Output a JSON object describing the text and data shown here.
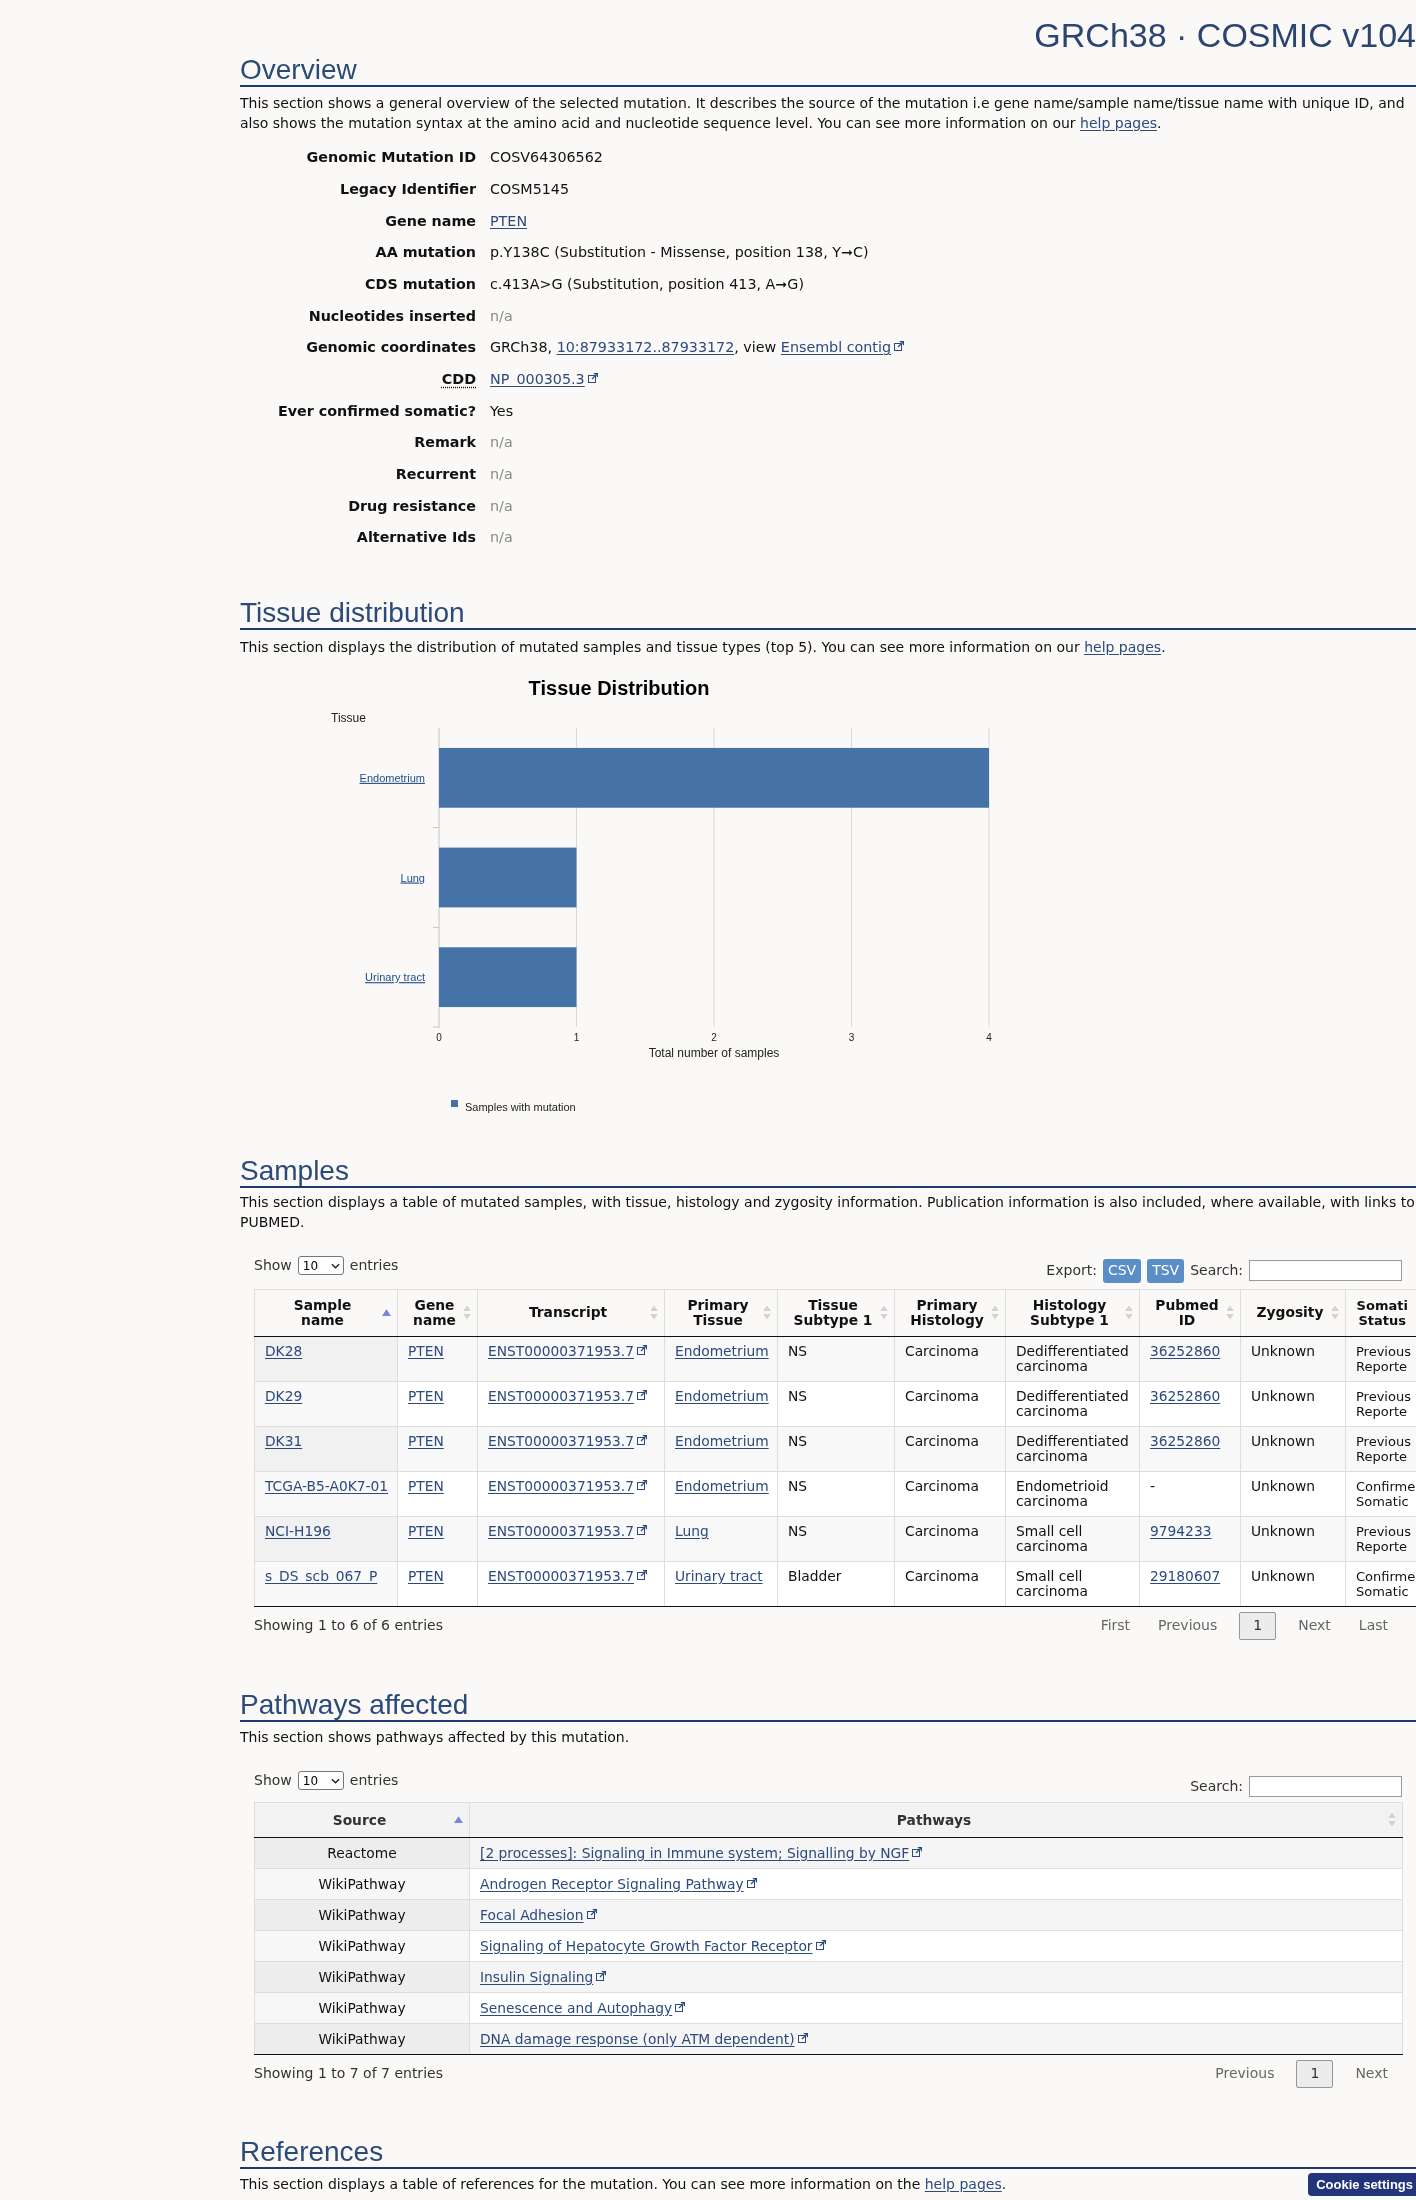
{
  "header": {
    "title": "GRCh38 · COSMIC v104"
  },
  "overview": {
    "heading": "Overview",
    "description": {
      "text": "This section shows a general overview of the selected mutation. It describes the source of the mutation i.e gene name/sample name/tissue name with unique ID, and also shows the mutation syntax at the amino acid and nucleotide sequence level. You can see more information on our ",
      "link": "help pages",
      "end": "."
    },
    "fields": [
      {
        "label": "Genomic Mutation ID",
        "abbreviation": false,
        "value": [
          {
            "kind": "text",
            "text": "COSV64306562"
          }
        ]
      },
      {
        "label": "Legacy Identifier",
        "abbreviation": false,
        "value": [
          {
            "kind": "text",
            "text": "COSM5145"
          }
        ]
      },
      {
        "label": "Gene name",
        "abbreviation": false,
        "value": [
          {
            "kind": "link",
            "text": "PTEN"
          }
        ]
      },
      {
        "label": "AA mutation",
        "abbreviation": false,
        "value": [
          {
            "kind": "text",
            "text": "p.Y138C (Substitution - Missense, position 138, Y➞C)"
          }
        ]
      },
      {
        "label": "CDS mutation",
        "abbreviation": false,
        "value": [
          {
            "kind": "text",
            "text": "c.413A>G (Substitution, position 413, A➞G)"
          }
        ]
      },
      {
        "label": "Nucleotides inserted",
        "abbreviation": false,
        "value": [
          {
            "kind": "na",
            "text": "n/a"
          }
        ]
      },
      {
        "label": "Genomic coordinates",
        "abbreviation": false,
        "value": [
          {
            "kind": "text",
            "text": "GRCh38, "
          },
          {
            "kind": "link",
            "text": "10:87933172..87933172"
          },
          {
            "kind": "text",
            "text": ", view "
          },
          {
            "kind": "external_link",
            "text": "Ensembl contig"
          }
        ]
      },
      {
        "label": "CDD",
        "abbreviation": true,
        "value": [
          {
            "kind": "external_link",
            "text": "NP_000305.3"
          }
        ]
      },
      {
        "label": "Ever confirmed somatic?",
        "abbreviation": false,
        "value": [
          {
            "kind": "text",
            "text": "Yes"
          }
        ]
      },
      {
        "label": "Remark",
        "abbreviation": false,
        "value": [
          {
            "kind": "na",
            "text": "n/a"
          }
        ]
      },
      {
        "label": "Recurrent",
        "abbreviation": false,
        "value": [
          {
            "kind": "na",
            "text": "n/a"
          }
        ]
      },
      {
        "label": "Drug resistance",
        "abbreviation": false,
        "value": [
          {
            "kind": "na",
            "text": "n/a"
          }
        ]
      },
      {
        "label": "Alternative Ids",
        "abbreviation": false,
        "value": [
          {
            "kind": "na",
            "text": "n/a"
          }
        ]
      }
    ]
  },
  "tissue_distribution": {
    "heading": "Tissue distribution",
    "description": {
      "text": "This section displays the distribution of mutated samples and tissue types (top 5). You can see more information on our ",
      "link": "help pages",
      "end": "."
    },
    "chart_data": {
      "type": "bar",
      "orientation": "horizontal",
      "title": "Tissue Distribution",
      "ylabel": "Tissue",
      "xlabel": "Total number of samples",
      "categories": [
        "Endometrium",
        "Lung",
        "Urinary tract"
      ],
      "series": [
        {
          "name": "Samples with mutation",
          "color": "#4673a7",
          "values": [
            4,
            1,
            1
          ]
        }
      ],
      "xlim": [
        0,
        4
      ],
      "xticks": [
        0,
        1,
        2,
        3,
        4
      ],
      "grid": true
    }
  },
  "samples": {
    "heading": "Samples",
    "description": {
      "text": "This section displays a table of mutated samples, with tissue, histology and zygosity information. Publication information is also included, where available, with links to PUBMED."
    },
    "length_menu": {
      "label_before": "Show",
      "value": "10",
      "label_after": "entries"
    },
    "export": {
      "label": "Export:",
      "buttons": [
        "CSV",
        "TSV"
      ]
    },
    "search": {
      "label": "Search:"
    },
    "table": {
      "columns": [
        {
          "label": "Sample name",
          "sorted": true
        },
        {
          "label": "Gene name",
          "sorted": false
        },
        {
          "label": "Transcript",
          "sorted": false
        },
        {
          "label": "Primary Tissue",
          "sorted": false
        },
        {
          "label": "Tissue Subtype 1",
          "sorted": false
        },
        {
          "label": "Primary Histology",
          "sorted": false
        },
        {
          "label": "Histology Subtype 1",
          "sorted": false
        },
        {
          "label": "Pubmed ID",
          "sorted": false
        },
        {
          "label": "Zygosity",
          "sorted": false
        },
        {
          "label": "Somati Status"
        }
      ],
      "rows": [
        [
          {
            "kind": "link",
            "text": "DK28"
          },
          {
            "kind": "link",
            "text": "PTEN"
          },
          {
            "kind": "external_link",
            "text": "ENST00000371953.7"
          },
          {
            "kind": "link",
            "text": "Endometrium"
          },
          {
            "kind": "text",
            "text": "NS"
          },
          {
            "kind": "text",
            "text": "Carcinoma"
          },
          {
            "kind": "text",
            "text": "Dedifferentiated carcinoma"
          },
          {
            "kind": "link",
            "text": "36252860"
          },
          {
            "kind": "text",
            "text": "Unknown"
          },
          {
            "kind": "text",
            "text": "Previous Reporte"
          }
        ],
        [
          {
            "kind": "link",
            "text": "DK29"
          },
          {
            "kind": "link",
            "text": "PTEN"
          },
          {
            "kind": "external_link",
            "text": "ENST00000371953.7"
          },
          {
            "kind": "link",
            "text": "Endometrium"
          },
          {
            "kind": "text",
            "text": "NS"
          },
          {
            "kind": "text",
            "text": "Carcinoma"
          },
          {
            "kind": "text",
            "text": "Dedifferentiated carcinoma"
          },
          {
            "kind": "link",
            "text": "36252860"
          },
          {
            "kind": "text",
            "text": "Unknown"
          },
          {
            "kind": "text",
            "text": "Previous Reporte"
          }
        ],
        [
          {
            "kind": "link",
            "text": "DK31"
          },
          {
            "kind": "link",
            "text": "PTEN"
          },
          {
            "kind": "external_link",
            "text": "ENST00000371953.7"
          },
          {
            "kind": "link",
            "text": "Endometrium"
          },
          {
            "kind": "text",
            "text": "NS"
          },
          {
            "kind": "text",
            "text": "Carcinoma"
          },
          {
            "kind": "text",
            "text": "Dedifferentiated carcinoma"
          },
          {
            "kind": "link",
            "text": "36252860"
          },
          {
            "kind": "text",
            "text": "Unknown"
          },
          {
            "kind": "text",
            "text": "Previous Reporte"
          }
        ],
        [
          {
            "kind": "link",
            "text": "TCGA-B5-A0K7-01"
          },
          {
            "kind": "link",
            "text": "PTEN"
          },
          {
            "kind": "external_link",
            "text": "ENST00000371953.7"
          },
          {
            "kind": "link",
            "text": "Endometrium"
          },
          {
            "kind": "text",
            "text": "NS"
          },
          {
            "kind": "text",
            "text": "Carcinoma"
          },
          {
            "kind": "text",
            "text": "Endometrioid carcinoma"
          },
          {
            "kind": "text",
            "text": "-"
          },
          {
            "kind": "text",
            "text": "Unknown"
          },
          {
            "kind": "text",
            "text": "Confirme Somatic"
          }
        ],
        [
          {
            "kind": "link",
            "text": "NCI-H196"
          },
          {
            "kind": "link",
            "text": "PTEN"
          },
          {
            "kind": "external_link",
            "text": "ENST00000371953.7"
          },
          {
            "kind": "link",
            "text": "Lung"
          },
          {
            "kind": "text",
            "text": "NS"
          },
          {
            "kind": "text",
            "text": "Carcinoma"
          },
          {
            "kind": "text",
            "text": "Small cell carcinoma"
          },
          {
            "kind": "link",
            "text": "9794233"
          },
          {
            "kind": "text",
            "text": "Unknown"
          },
          {
            "kind": "text",
            "text": "Previous Reporte"
          }
        ],
        [
          {
            "kind": "link",
            "text": "s_DS_scb_067_P"
          },
          {
            "kind": "link",
            "text": "PTEN"
          },
          {
            "kind": "external_link",
            "text": "ENST00000371953.7"
          },
          {
            "kind": "link",
            "text": "Urinary tract"
          },
          {
            "kind": "text",
            "text": "Bladder"
          },
          {
            "kind": "text",
            "text": "Carcinoma"
          },
          {
            "kind": "text",
            "text": "Small cell carcinoma"
          },
          {
            "kind": "link",
            "text": "29180607"
          },
          {
            "kind": "text",
            "text": "Unknown"
          },
          {
            "kind": "text",
            "text": "Confirme Somatic"
          }
        ]
      ]
    },
    "info": "Showing 1 to 6 of 6 entries",
    "pagination": [
      {
        "kind": "nav",
        "label": "First",
        "disabled": true
      },
      {
        "kind": "nav",
        "label": "Previous",
        "disabled": true
      },
      {
        "kind": "page",
        "label": "1",
        "selected": true
      },
      {
        "kind": "nav",
        "label": "Next",
        "disabled": true
      },
      {
        "kind": "nav",
        "label": "Last",
        "disabled": true
      }
    ]
  },
  "pathways": {
    "heading": "Pathways affected",
    "description": {
      "text": "This section shows pathways affected by this mutation."
    },
    "length_menu": {
      "label_before": "Show",
      "value": "10",
      "label_after": "entries"
    },
    "search": {
      "label": "Search:"
    },
    "table": {
      "columns": [
        {
          "label": "Source",
          "sorted": true
        },
        {
          "label": "Pathways",
          "sorted": false
        }
      ],
      "rows": [
        {
          "source": "Reactome",
          "pathway": "[2 processes]: Signaling in Immune system; Signalling by NGF"
        },
        {
          "source": "WikiPathway",
          "pathway": "Androgen Receptor Signaling Pathway"
        },
        {
          "source": "WikiPathway",
          "pathway": "Focal Adhesion"
        },
        {
          "source": "WikiPathway",
          "pathway": "Signaling of Hepatocyte Growth Factor Receptor"
        },
        {
          "source": "WikiPathway",
          "pathway": "Insulin Signaling"
        },
        {
          "source": "WikiPathway",
          "pathway": "Senescence and Autophagy"
        },
        {
          "source": "WikiPathway",
          "pathway": "DNA damage response (only ATM dependent)"
        }
      ]
    },
    "info": "Showing 1 to 7 of 7 entries",
    "pagination": [
      {
        "kind": "nav",
        "label": "Previous",
        "disabled": true
      },
      {
        "kind": "page",
        "label": "1",
        "selected": true
      },
      {
        "kind": "nav",
        "label": "Next",
        "disabled": true
      }
    ]
  },
  "references": {
    "heading": "References",
    "description": {
      "text": "This section displays a table of references for the mutation. You can see more information on the ",
      "link": "help pages",
      "end": "."
    }
  },
  "cookie_button": {
    "label": "Cookie settings"
  }
}
